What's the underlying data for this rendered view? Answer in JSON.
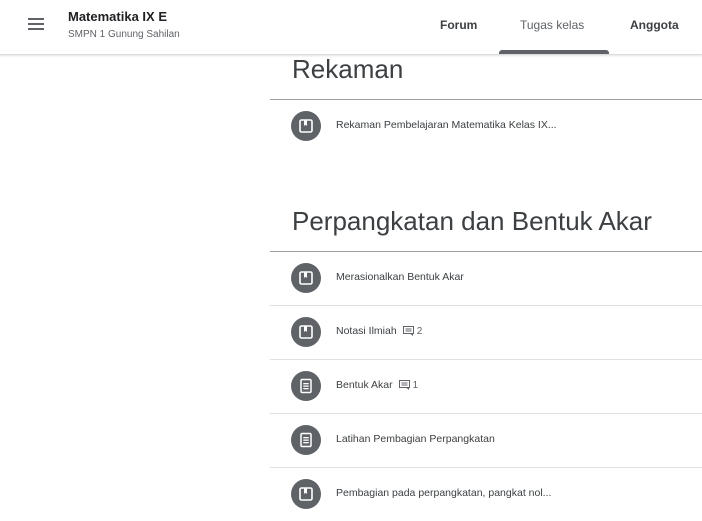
{
  "header": {
    "class_title": "Matematika IX E",
    "class_subtitle": "SMPN 1 Gunung Sahilan",
    "menu_icon": "hamburger-menu-icon"
  },
  "tabs": [
    {
      "label": "Forum",
      "active": false
    },
    {
      "label": "Tugas kelas",
      "active": true
    },
    {
      "label": "Anggota",
      "active": false
    }
  ],
  "sections": [
    {
      "title": "Rekaman",
      "items": [
        {
          "title": "Rekaman Pembelajaran Matematika Kelas IX...",
          "icon": "material-icon"
        }
      ]
    },
    {
      "title": "Perpangkatan dan Bentuk Akar",
      "items": [
        {
          "title": "Merasionalkan Bentuk Akar",
          "icon": "material-icon"
        },
        {
          "title": "Notasi Ilmiah",
          "icon": "material-icon",
          "comments": "2"
        },
        {
          "title": "Bentuk Akar",
          "icon": "assignment-icon",
          "comments": "1"
        },
        {
          "title": "Latihan Pembagian Perpangkatan",
          "icon": "assignment-icon"
        },
        {
          "title": "Pembagian pada perpangkatan, pangkat nol...",
          "icon": "material-icon"
        }
      ]
    }
  ],
  "colors": {
    "icon_bg": "#5f6368",
    "text": "#3c4043",
    "divider": "#e0e0e0"
  }
}
